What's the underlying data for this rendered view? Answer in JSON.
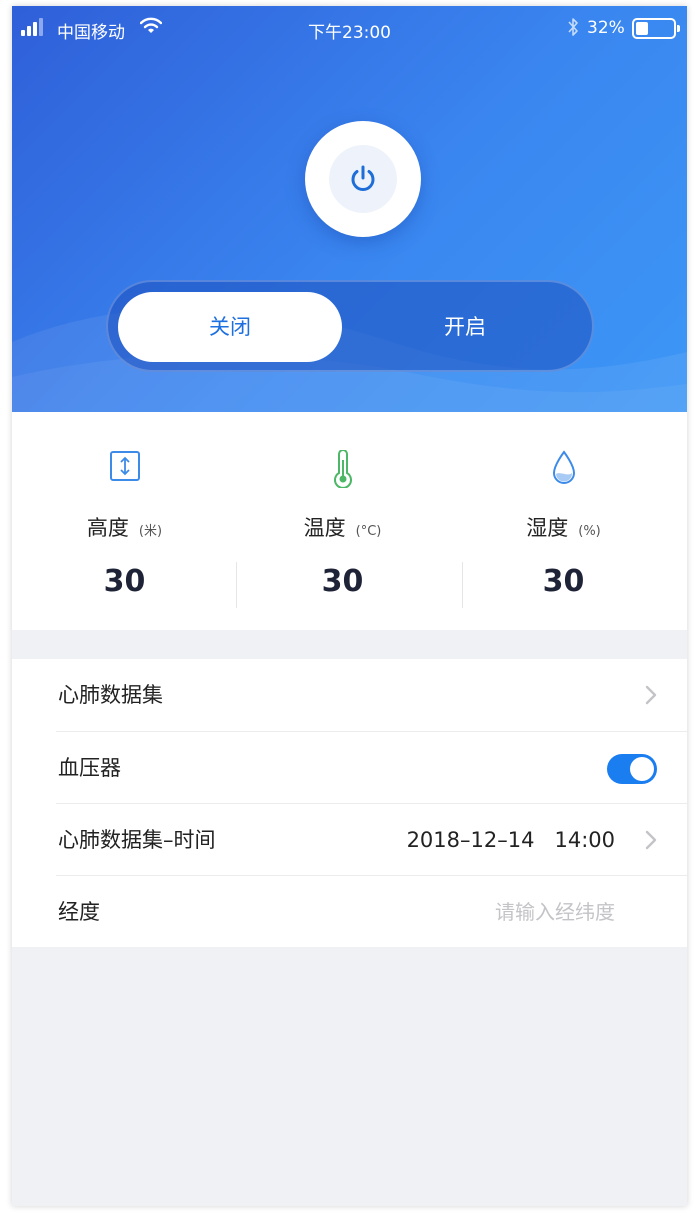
{
  "status_bar": {
    "carrier": "中国移动",
    "time": "下午23:00",
    "battery": "32%",
    "battery_level": 0.32,
    "icons": [
      "signal-icon",
      "wifi-icon",
      "bluetooth-icon",
      "battery-icon"
    ]
  },
  "header": {
    "power_icon": "power-icon",
    "switch": {
      "off_label": "关闭",
      "on_label": "开启",
      "selected": "off"
    }
  },
  "stats": [
    {
      "icon": "height-icon",
      "label": "高度",
      "unit": "(米)",
      "value": "30"
    },
    {
      "icon": "thermometer-icon",
      "label": "温度",
      "unit": "(°C)",
      "value": "30"
    },
    {
      "icon": "water-drop-icon",
      "label": "湿度",
      "unit": "(%)",
      "value": "30"
    }
  ],
  "list": {
    "items": [
      {
        "label": "心肺数据集",
        "type": "link"
      },
      {
        "label": "血压器",
        "type": "toggle",
        "on": true
      },
      {
        "label": "心肺数据集–时间",
        "type": "link",
        "value": "2018–12–14   14:00"
      },
      {
        "label": "经度",
        "type": "input",
        "placeholder": "请输入经纬度"
      }
    ]
  },
  "colors": {
    "accent": "#1b7ef0",
    "header_gradient_start": "#2f5fd9",
    "header_gradient_end": "#3d97f6",
    "thermometer": "#4cb867",
    "background": "#f0f1f4"
  }
}
